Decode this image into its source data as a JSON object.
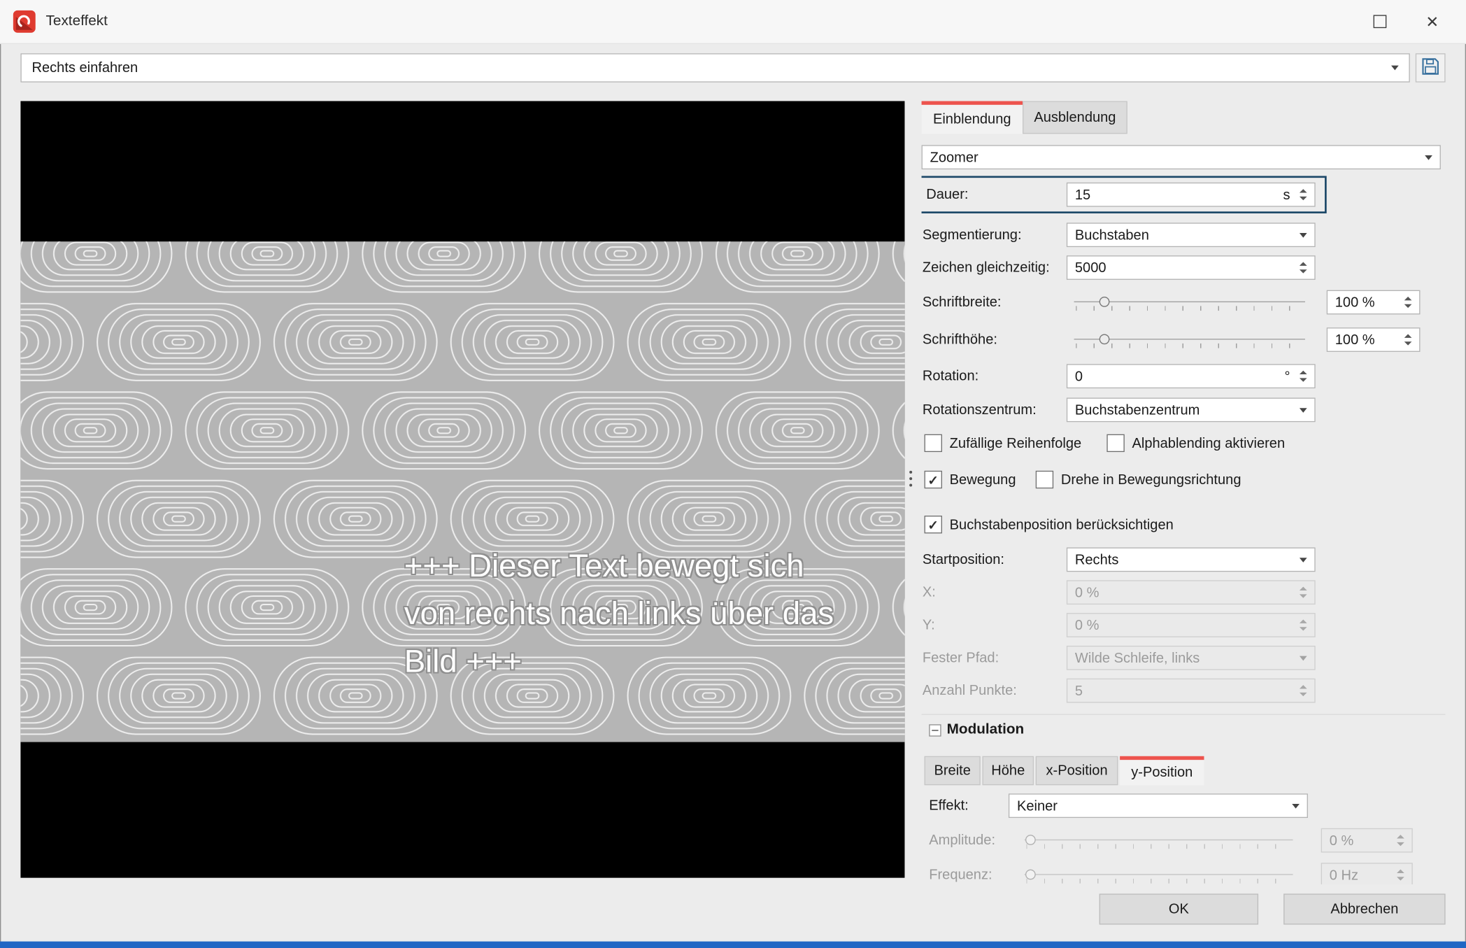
{
  "colors": {
    "accent_red": "#ed544e",
    "focus_border_blue": "#1c4868",
    "bottom_strip_blue": "#2166c4",
    "preview_background": "#000000",
    "pattern_gray": "#b5b5b5"
  },
  "window": {
    "title": "Texteffekt"
  },
  "icons": {
    "close_glyph": "✕",
    "check_glyph": "✓"
  },
  "preset": {
    "value": "Rechts einfahren"
  },
  "preview": {
    "caption_line1": "+++ Dieser Text bewegt sich",
    "caption_line2": "von rechts nach links über das",
    "caption_line3": "Bild +++"
  },
  "tabs": {
    "einblendung": "Einblendung",
    "ausblendung": "Ausblendung"
  },
  "effect_select": {
    "value": "Zoomer"
  },
  "rows": {
    "dauer": {
      "label": "Dauer:",
      "value": "15",
      "unit": "s",
      "highlighted": true
    },
    "segmentierung": {
      "label": "Segmentierung:",
      "value": "Buchstaben"
    },
    "zeichen": {
      "label": "Zeichen gleichzeitig:",
      "value": "5000"
    },
    "schriftbreite": {
      "label": "Schriftbreite:",
      "value": "100 %",
      "slider_percent": 13
    },
    "schrifthoehe": {
      "label": "Schrifthöhe:",
      "value": "100 %",
      "slider_percent": 13
    },
    "rotation": {
      "label": "Rotation:",
      "value": "0",
      "unit": "°"
    },
    "rotationszentrum": {
      "label": "Rotationszentrum:",
      "value": "Buchstabenzentrum"
    },
    "startposition": {
      "label": "Startposition:",
      "value": "Rechts"
    },
    "x": {
      "label": "X:",
      "value": "0 %",
      "disabled": true
    },
    "y": {
      "label": "Y:",
      "value": "0 %",
      "disabled": true
    },
    "fester_pfad": {
      "label": "Fester Pfad:",
      "value": "Wilde Schleife, links",
      "disabled": true
    },
    "anzahl_punkte": {
      "label": "Anzahl Punkte:",
      "value": "5",
      "disabled": true
    }
  },
  "checkboxes": {
    "zufaellige": {
      "label": "Zufällige Reihenfolge",
      "checked": false
    },
    "alphablending": {
      "label": "Alphablending aktivieren",
      "checked": false
    },
    "bewegung": {
      "label": "Bewegung",
      "checked": true
    },
    "drehe": {
      "label": "Drehe in Bewegungsrichtung",
      "checked": false
    },
    "buchstabenposition": {
      "label": "Buchstabenposition berücksichtigen",
      "checked": true
    }
  },
  "modulation": {
    "title": "Modulation",
    "tabs": {
      "breite": "Breite",
      "hoehe": "Höhe",
      "x_position": "x-Position",
      "y_position": "y-Position"
    },
    "active_tab": "y-Position",
    "effekt": {
      "label": "Effekt:",
      "value": "Keiner"
    },
    "amplitude": {
      "label": "Amplitude:",
      "value": "0 %",
      "disabled": true,
      "slider_percent": 0
    },
    "frequenz": {
      "label": "Frequenz:",
      "value": "0 Hz",
      "disabled": true,
      "slider_percent": 0
    }
  },
  "footer": {
    "ok": "OK",
    "cancel": "Abbrechen"
  }
}
